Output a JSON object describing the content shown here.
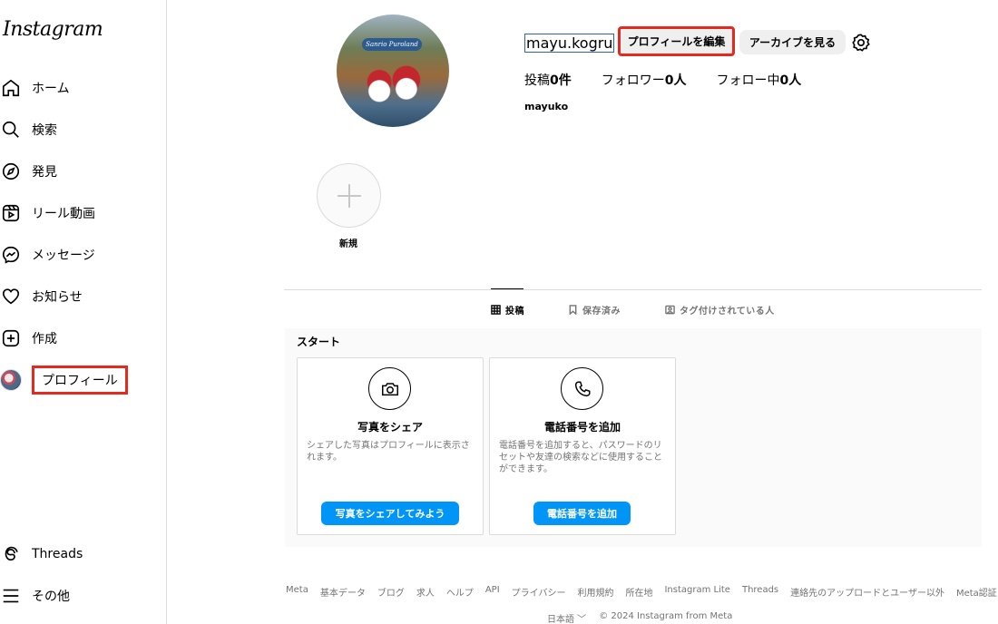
{
  "sidebar": {
    "logo": "Instagram",
    "items": [
      {
        "label": "ホーム",
        "icon": "home-icon"
      },
      {
        "label": "検索",
        "icon": "search-icon"
      },
      {
        "label": "発見",
        "icon": "compass-icon"
      },
      {
        "label": "リール動画",
        "icon": "reels-icon"
      },
      {
        "label": "メッセージ",
        "icon": "messenger-icon"
      },
      {
        "label": "お知らせ",
        "icon": "heart-icon"
      },
      {
        "label": "作成",
        "icon": "plus-square-icon"
      },
      {
        "label": "プロフィール",
        "icon": "avatar"
      }
    ],
    "bottom": [
      {
        "label": "Threads",
        "icon": "threads-icon"
      },
      {
        "label": "その他",
        "icon": "menu-icon"
      }
    ]
  },
  "profile": {
    "avatar_banner": "Sanrio Puroland",
    "username": "mayu.kogru",
    "edit_label": "プロフィールを編集",
    "archive_label": "アーカイブを見る",
    "stats": {
      "posts_prefix": "投稿",
      "posts_value": "0件",
      "followers_prefix": "フォロワー",
      "followers_value": "0人",
      "following_prefix": "フォロー中",
      "following_value": "0人"
    },
    "full_name": "mayuko"
  },
  "story": {
    "new_label": "新規"
  },
  "tabs": [
    {
      "label": "投稿",
      "icon": "grid-icon"
    },
    {
      "label": "保存済み",
      "icon": "bookmark-icon"
    },
    {
      "label": "タグ付けされている人",
      "icon": "tag-person-icon"
    }
  ],
  "start": {
    "title": "スタート",
    "cards": [
      {
        "icon": "camera-icon",
        "title": "写真をシェア",
        "desc": "シェアした写真はプロフィールに表示されます。",
        "button": "写真をシェアしてみよう"
      },
      {
        "icon": "phone-icon",
        "title": "電話番号を追加",
        "desc": "電話番号を追加すると、パスワードのリセットや友達の検索などに使用することができます。",
        "button": "電話番号を追加"
      }
    ]
  },
  "footer": {
    "links": [
      "Meta",
      "基本データ",
      "ブログ",
      "求人",
      "ヘルプ",
      "API",
      "プライバシー",
      "利用規約",
      "所在地",
      "Instagram Lite",
      "Threads",
      "連絡先のアップロードとユーザー以外",
      "Meta認証"
    ],
    "language": "日本語 ﹀",
    "copyright": "© 2024 Instagram from Meta"
  },
  "colors": {
    "accent": "#0095f6",
    "highlight": "#e5291f",
    "border": "#dbdbdb"
  }
}
